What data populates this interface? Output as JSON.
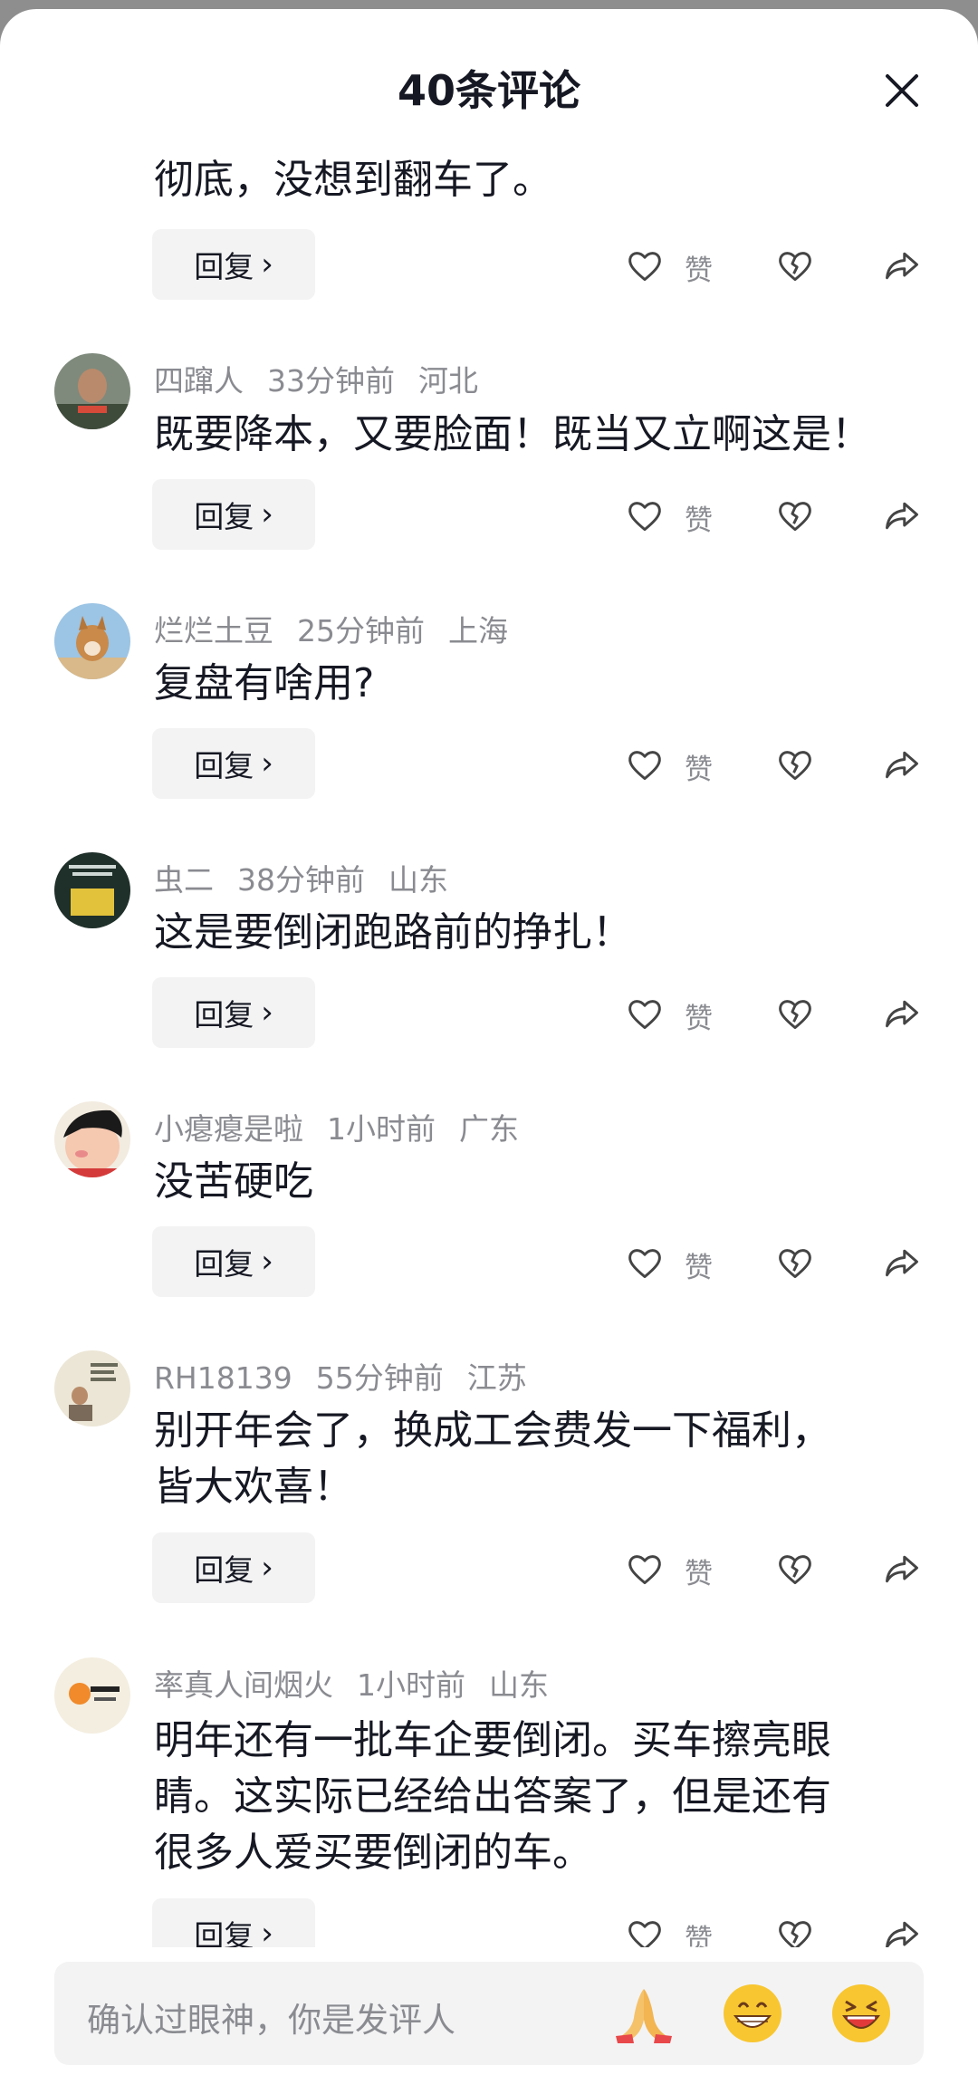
{
  "header": {
    "title": "40条评论"
  },
  "actions": {
    "reply_label": "回复",
    "like_label": "赞"
  },
  "comments": [
    {
      "text_lines": [
        "彻底，没想到翻车了。"
      ]
    },
    {
      "username": "四蹿人",
      "time": "33分钟前",
      "location": "河北",
      "text_lines": [
        "既要降本，又要脸面！既当又立啊这是！"
      ]
    },
    {
      "username": "烂烂土豆",
      "time": "25分钟前",
      "location": "上海",
      "text_lines": [
        "复盘有啥用?"
      ]
    },
    {
      "username": "虫二",
      "time": "38分钟前",
      "location": "山东",
      "text_lines": [
        "这是要倒闭跑路前的挣扎！"
      ]
    },
    {
      "username": "小瘪瘪是啦",
      "time": "1小时前",
      "location": "广东",
      "text_lines": [
        "没苦硬吃"
      ]
    },
    {
      "username": "RH18139",
      "time": "55分钟前",
      "location": "江苏",
      "text_lines": [
        "别开年会了，换成工会费发一下福利，",
        "皆大欢喜！"
      ]
    },
    {
      "username": "率真人间烟火",
      "time": "1小时前",
      "location": "山东",
      "text_lines": [
        "明年还有一批车企要倒闭。买车擦亮眼",
        "睛。这实际已经给出答案了，但是还有",
        "很多人爱买要倒闭的车。"
      ]
    }
  ],
  "composer": {
    "placeholder": "确认过眼神，你是发评人",
    "emojis": [
      "pray-emoji",
      "grin-emoji",
      "laugh-emoji"
    ]
  },
  "icons": [
    "close-icon",
    "heart-icon",
    "broken-heart-icon",
    "share-icon",
    "chevron-right-icon"
  ],
  "colors": {
    "text": "#161823",
    "secondary": "#8a8b91",
    "button_bg": "#f3f3f4"
  }
}
